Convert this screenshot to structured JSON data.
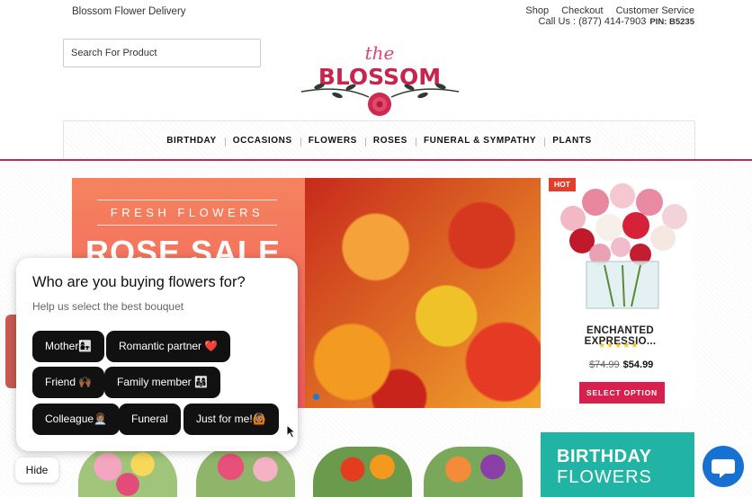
{
  "header": {
    "brand": "Blossom Flower Delivery",
    "links": [
      "Shop",
      "Checkout",
      "Customer Service"
    ],
    "phone": "Call Us : (877) 414-7903",
    "pin": "PIN: B5235"
  },
  "search": {
    "placeholder": "Search For Product"
  },
  "logo": {
    "small": "the",
    "main": "BLOSSOM"
  },
  "nav": [
    "BIRTHDAY",
    "OCCASIONS",
    "FLOWERS",
    "ROSES",
    "FUNERAL & SYMPATHY",
    "PLANTS"
  ],
  "hero": {
    "eyebrow": "FRESH FLOWERS",
    "headline": "ROSE SALE"
  },
  "product": {
    "badge": "HOT",
    "name": "ENCHANTED EXPRESSIO...",
    "rating": 5,
    "stars": "★★★★★",
    "old_price": "$74.99",
    "new_price": "$54.99",
    "button": "SELECT OPTION"
  },
  "promo": {
    "line1": "BIRTHDAY",
    "line2": "FLOWERS"
  },
  "popup": {
    "question": "Who are you buying flowers for?",
    "subtitle": "Help us select the best bouquet",
    "options": [
      "Mother👩‍👧",
      "Romantic partner ❤️",
      "Friend 🙌🏾",
      "Family member 👨‍👩‍👧",
      "Colleague👩🏽‍💼",
      "Funeral",
      "Just for me!🙆🏽"
    ],
    "hide": "Hide"
  },
  "colors": {
    "accent": "#d6214f",
    "nav_line": "#c12d4e",
    "promo": "#21b3a3",
    "chat": "#1771d3"
  }
}
